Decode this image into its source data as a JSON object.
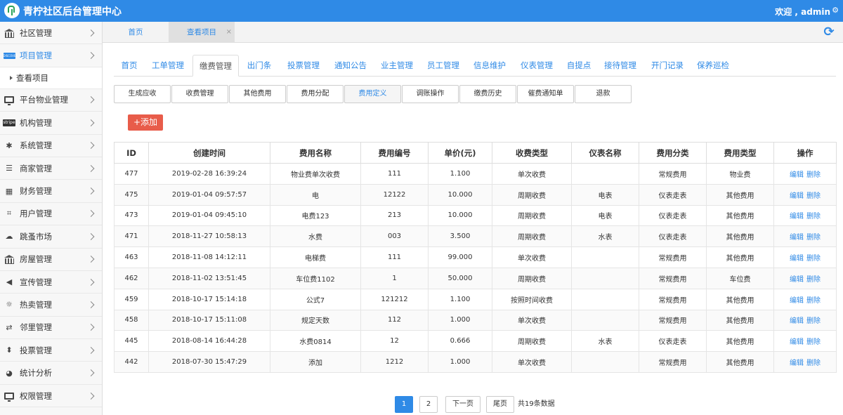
{
  "header": {
    "app_title": "青柠社区后台管理中心",
    "welcome": "欢迎 , admin",
    "settings_icon": "gear-icon"
  },
  "sidebar": {
    "items": [
      {
        "label": "社区管理",
        "icon": "bank-icon"
      },
      {
        "label": "项目管理",
        "icon": "card-icon",
        "active": true
      },
      {
        "label": "查看项目",
        "sub": true
      },
      {
        "label": "平台物业管理",
        "icon": "monitor-icon"
      },
      {
        "label": "机构管理",
        "icon": "stripe-icon"
      },
      {
        "label": "系统管理",
        "icon": "yelp-icon"
      },
      {
        "label": "商家管理",
        "icon": "bars-icon"
      },
      {
        "label": "财务管理",
        "icon": "calculator-icon"
      },
      {
        "label": "用户管理",
        "icon": "crop-icon"
      },
      {
        "label": "跳蚤市场",
        "icon": "cloud-icon"
      },
      {
        "label": "房屋管理",
        "icon": "bank-icon"
      },
      {
        "label": "宣传管理",
        "icon": "volume-icon"
      },
      {
        "label": "热卖管理",
        "icon": "sun-icon"
      },
      {
        "label": "邻里管理",
        "icon": "retweet-icon"
      },
      {
        "label": "投票管理",
        "icon": "sort-icon"
      },
      {
        "label": "统计分析",
        "icon": "pie-chart-icon"
      },
      {
        "label": "权限管理",
        "icon": "monitor-icon"
      }
    ]
  },
  "tabs": {
    "home": "首页",
    "view": "查看项目",
    "close": "×"
  },
  "main_nav": [
    "首页",
    "工单管理",
    "缴费管理",
    "出门条",
    "投票管理",
    "通知公告",
    "业主管理",
    "员工管理",
    "信息维护",
    "仪表管理",
    "自提点",
    "接待管理",
    "开门记录",
    "保养巡检"
  ],
  "main_nav_active": "缴费管理",
  "sub_buttons": [
    "生成应收",
    "收费管理",
    "其他费用",
    "费用分配",
    "费用定义",
    "调账操作",
    "缴费历史",
    "催费通知单",
    "退款"
  ],
  "sub_active": "费用定义",
  "add_label": "+添加",
  "table": {
    "columns": [
      "ID",
      "创建时间",
      "费用名称",
      "费用编号",
      "单价(元)",
      "收费类型",
      "仪表名称",
      "费用分类",
      "费用类型",
      "操作"
    ],
    "rows": [
      [
        "477",
        "2019-02-28 16:39:24",
        "物业费单次收费",
        "111",
        "1.100",
        "单次收费",
        "",
        "常规费用",
        "物业费"
      ],
      [
        "475",
        "2019-01-04 09:57:57",
        "电",
        "12122",
        "10.000",
        "周期收费",
        "电表",
        "仪表走表",
        "其他费用"
      ],
      [
        "473",
        "2019-01-04 09:45:10",
        "电费123",
        "213",
        "10.000",
        "周期收费",
        "电表",
        "仪表走表",
        "其他费用"
      ],
      [
        "471",
        "2018-11-27 10:58:13",
        "水费",
        "003",
        "3.500",
        "周期收费",
        "水表",
        "仪表走表",
        "其他费用"
      ],
      [
        "463",
        "2018-11-08 14:12:11",
        "电梯费",
        "111",
        "99.000",
        "单次收费",
        "",
        "常规费用",
        "其他费用"
      ],
      [
        "462",
        "2018-11-02 13:51:45",
        "车位费1102",
        "1",
        "50.000",
        "周期收费",
        "",
        "常规费用",
        "车位费"
      ],
      [
        "459",
        "2018-10-17 15:14:18",
        "公式7",
        "121212",
        "1.100",
        "按照时间收费",
        "",
        "常规费用",
        "其他费用"
      ],
      [
        "458",
        "2018-10-17 15:11:08",
        "规定天数",
        "112",
        "1.000",
        "单次收费",
        "",
        "常规费用",
        "其他费用"
      ],
      [
        "445",
        "2018-08-14 16:44:28",
        "水费0814",
        "12",
        "0.666",
        "周期收费",
        "水表",
        "仪表走表",
        "其他费用"
      ],
      [
        "442",
        "2018-07-30 15:47:29",
        "添加",
        "1212",
        "1.000",
        "单次收费",
        "",
        "常规费用",
        "其他费用"
      ]
    ],
    "edit_label": "编辑",
    "delete_label": "删除"
  },
  "pager": {
    "pages": [
      "1",
      "2"
    ],
    "current": "1",
    "next": "下一页",
    "last": "尾页",
    "total": "共19条数据"
  }
}
